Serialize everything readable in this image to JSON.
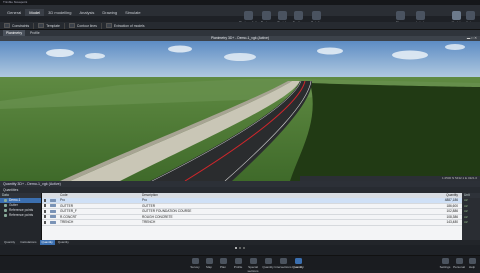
{
  "window": {
    "title": "Trimble Novapoint"
  },
  "menu_tabs": [
    {
      "label": "General",
      "active": false
    },
    {
      "label": "Model",
      "active": true
    },
    {
      "label": "3D modelling",
      "active": false
    },
    {
      "label": "Analysis",
      "active": false
    },
    {
      "label": "Drawing",
      "active": false
    },
    {
      "label": "Simulate",
      "active": false
    }
  ],
  "ribbon_right": [
    {
      "label": "Photorealistic",
      "icon": "photo-icon"
    },
    {
      "label": "Review",
      "icon": "eye-icon"
    },
    {
      "label": "Sketch",
      "icon": "sketch-icon"
    },
    {
      "label": "Section",
      "icon": "section-icon"
    },
    {
      "label": "Details",
      "icon": "details-icon"
    },
    {
      "label": "Share",
      "icon": "share-icon"
    },
    {
      "label": "Label",
      "icon": "label-icon"
    },
    {
      "label": "Model settings",
      "icon": "settings-icon"
    },
    {
      "label": "Help",
      "icon": "help-icon"
    }
  ],
  "toolbar": {
    "constraints_label": "Constraints",
    "template_label": "Template",
    "contour_lines_label": "Contour lines",
    "extraction_label": "Extraction of models"
  },
  "view_tabs": [
    {
      "label": "Planimetry",
      "active": true
    },
    {
      "label": "Profile",
      "active": false
    }
  ],
  "view": {
    "title": "Planimetry 3D+ - Demo-1_vgk (Active)"
  },
  "viewport_status": "1:2500  N 5432.1  E 4321.0",
  "quantity_panel": {
    "title": "Quantity 3D+ - Demo-1_vgk (Active)",
    "toolbar_label": "Quantities",
    "tree_header": "Data",
    "tree_items": [
      {
        "label": "Demo-1",
        "selected": true
      },
      {
        "label": "Gutter",
        "selected": false
      },
      {
        "label": "Reference points",
        "selected": false
      },
      {
        "label": "Reference points",
        "selected": false
      }
    ],
    "columns": [
      "Code",
      "Description",
      "Quantity"
    ],
    "rows": [
      {
        "code": "Pro",
        "description": "Pro",
        "quantity": "4887,186",
        "selected": true
      },
      {
        "code": "GUTTER",
        "description": "GUTTER",
        "quantity": "186,600",
        "selected": false
      },
      {
        "code": "GUTTER_F",
        "description": "GUTTER FOUNDATION COURSE",
        "quantity": "102,886",
        "selected": false
      },
      {
        "code": "R.CONCRT",
        "description": "ROUGH CONCRETE",
        "quantity": "108,386",
        "selected": false
      },
      {
        "code": "TRENCH",
        "description": "TRENCH",
        "quantity": "143,480",
        "selected": false
      }
    ],
    "right_header": "Unit",
    "units": [
      "m³",
      "m³",
      "m³",
      "m³",
      "m³"
    ],
    "bottom_tabs": [
      {
        "label": "Quantity",
        "active": false
      },
      {
        "label": "Calculations",
        "active": false
      },
      {
        "label": "Quantity",
        "active": true
      },
      {
        "label": "Quantity",
        "active": false
      }
    ]
  },
  "statusbar": {
    "items": [
      {
        "label": "Survey",
        "icon": "survey-icon",
        "active": false
      },
      {
        "label": "Map",
        "icon": "map-icon",
        "active": false
      },
      {
        "label": "Plan",
        "icon": "plan-icon",
        "active": false
      },
      {
        "label": "Profile",
        "icon": "profile-icon",
        "active": false
      },
      {
        "label": "Special sections",
        "icon": "sections-icon",
        "active": false
      },
      {
        "label": "Quantity",
        "icon": "quantity-icon",
        "active": false
      },
      {
        "label": "Intersections",
        "icon": "intersections-icon",
        "active": false
      },
      {
        "label": "Quantity",
        "icon": "quantity-icon",
        "active": true
      }
    ],
    "right_items": [
      {
        "label": "Settings",
        "icon": "gear-icon"
      },
      {
        "label": "Personal",
        "icon": "user-icon"
      },
      {
        "label": "Help",
        "icon": "help-icon"
      }
    ]
  },
  "colors": {
    "accent": "#3b6fb0",
    "sky_top": "#6f9ccf",
    "grass": "#4d7a34",
    "asphalt": "#2b2d2f",
    "road_line": "#d0262b"
  }
}
